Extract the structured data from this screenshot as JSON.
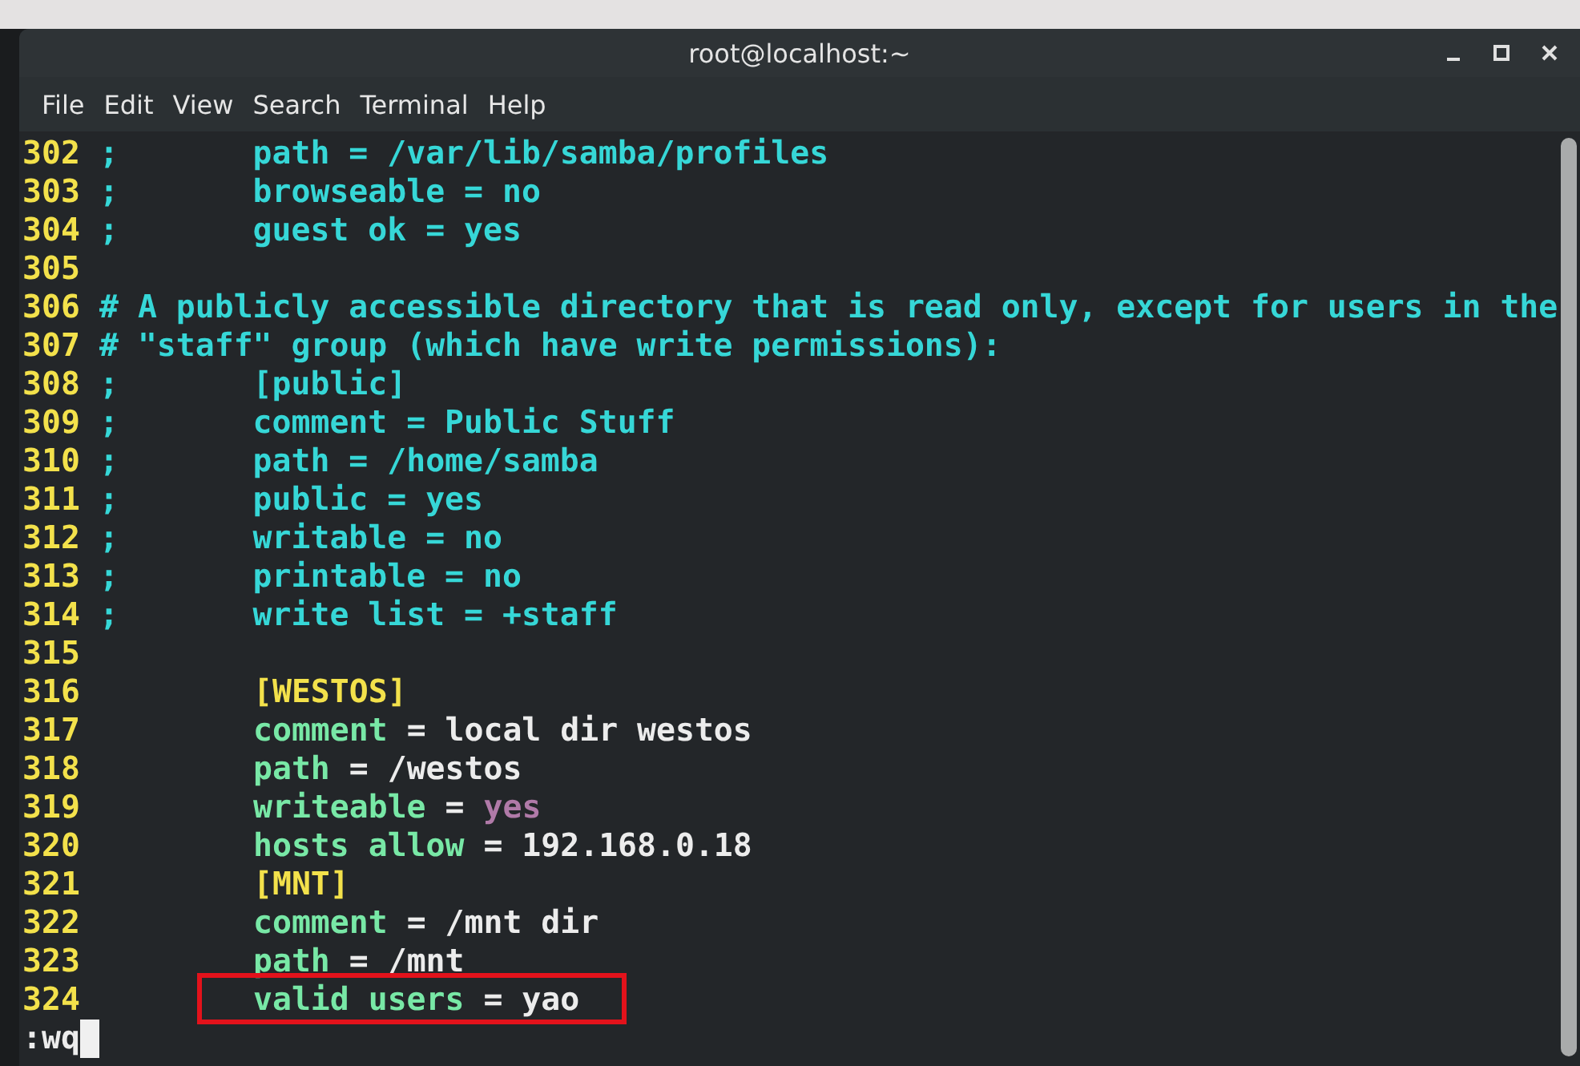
{
  "window": {
    "title": "root@localhost:~"
  },
  "menu": [
    "File",
    "Edit",
    "View",
    "Search",
    "Terminal",
    "Help"
  ],
  "lines": [
    {
      "number": "302",
      "segments": [
        {
          "kind": "comment",
          "text": ";       path = /var/lib/samba/profiles"
        }
      ]
    },
    {
      "number": "303",
      "segments": [
        {
          "kind": "comment",
          "text": ";       browseable = no"
        }
      ]
    },
    {
      "number": "304",
      "segments": [
        {
          "kind": "comment",
          "text": ";       guest ok = yes"
        }
      ]
    },
    {
      "number": "305"
    },
    {
      "number": "306",
      "segments": [
        {
          "kind": "comment",
          "text": "# A publicly accessible directory that is read only, except for users in the"
        }
      ]
    },
    {
      "number": "307",
      "segments": [
        {
          "kind": "comment",
          "text": "# \"staff\" group (which have write permissions):"
        }
      ]
    },
    {
      "number": "308",
      "segments": [
        {
          "kind": "comment",
          "text": ";       [public]"
        }
      ]
    },
    {
      "number": "309",
      "segments": [
        {
          "kind": "comment",
          "text": ";       comment = Public Stuff"
        }
      ]
    },
    {
      "number": "310",
      "segments": [
        {
          "kind": "comment",
          "text": ";       path = /home/samba"
        }
      ]
    },
    {
      "number": "311",
      "segments": [
        {
          "kind": "comment",
          "text": ";       public = yes"
        }
      ]
    },
    {
      "number": "312",
      "segments": [
        {
          "kind": "comment",
          "text": ";       writable = no"
        }
      ]
    },
    {
      "number": "313",
      "segments": [
        {
          "kind": "comment",
          "text": ";       printable = no"
        }
      ]
    },
    {
      "number": "314",
      "segments": [
        {
          "kind": "comment",
          "text": ";       write list = +staff"
        }
      ]
    },
    {
      "number": "315"
    },
    {
      "number": "316",
      "segments": [
        {
          "kind": "section",
          "text": "[WESTOS]"
        }
      ]
    },
    {
      "number": "317",
      "segments": [
        {
          "kind": "key",
          "text": "comment"
        },
        {
          "kind": "value",
          "text": "= local dir westos"
        }
      ]
    },
    {
      "number": "318",
      "segments": [
        {
          "kind": "key",
          "text": "path"
        },
        {
          "kind": "value",
          "text": "= /westos"
        }
      ]
    },
    {
      "number": "319",
      "segments": [
        {
          "kind": "key",
          "text": "writeable"
        },
        {
          "kind": "value",
          "text": "="
        },
        {
          "kind": "boolean",
          "text": "yes"
        }
      ]
    },
    {
      "number": "320",
      "segments": [
        {
          "kind": "key",
          "text": "hosts allow"
        },
        {
          "kind": "value",
          "text": "= 192.168.0.18"
        }
      ]
    },
    {
      "number": "321",
      "segments": [
        {
          "kind": "section",
          "text": "[MNT]"
        }
      ]
    },
    {
      "number": "322",
      "segments": [
        {
          "kind": "key",
          "text": "comment"
        },
        {
          "kind": "value",
          "text": "= /mnt dir"
        }
      ]
    },
    {
      "number": "323",
      "segments": [
        {
          "kind": "key",
          "text": "path"
        },
        {
          "kind": "value",
          "text": "= /mnt"
        }
      ]
    },
    {
      "number": "324",
      "highlighted": true,
      "segments": [
        {
          "kind": "key",
          "text": "valid users"
        },
        {
          "kind": "value",
          "text": "= yao"
        }
      ]
    }
  ],
  "command_line": {
    "text": ":wq",
    "cursor": true
  }
}
